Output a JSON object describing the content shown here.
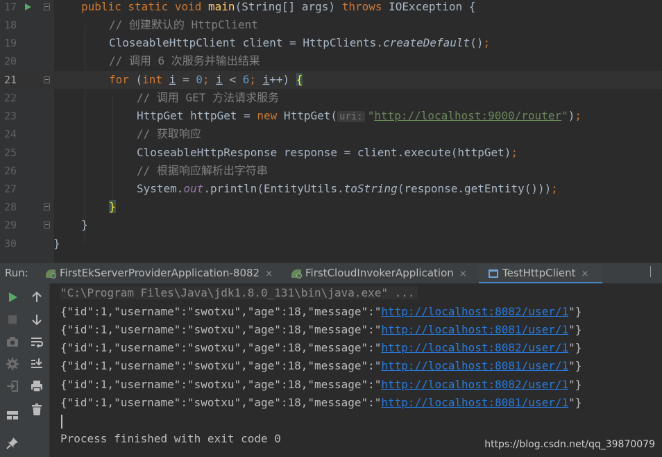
{
  "editor": {
    "line_numbers": [
      "17",
      "18",
      "19",
      "20",
      "21",
      "22",
      "23",
      "24",
      "25",
      "26",
      "27",
      "28",
      "29",
      "30"
    ],
    "line17": {
      "kw1": "public static void ",
      "fn": "main",
      "p1": "(String[] args) ",
      "kw2": "throws",
      "p2": " IOException {"
    },
    "line18": {
      "comment": "// 创建默认的 HttpClient"
    },
    "line19": {
      "p1": "CloseableHttpClient client = HttpClients.",
      "it": "createDefault",
      "p2": "()",
      "semi": ";"
    },
    "line20": {
      "comment": "// 调用 6 次服务并输出结果"
    },
    "line21": {
      "kw1": "for",
      "p1": " (",
      "kw2": "int",
      "sp": " ",
      "v1": "i",
      "p2": " = ",
      "n1": "0",
      "s1": "; ",
      "v2": "i",
      "p3": " < ",
      "n2": "6",
      "s2": "; ",
      "v3": "i",
      "p4": "++) ",
      "brace": "{"
    },
    "line22": {
      "comment": "// 调用 GET 方法请求服务"
    },
    "line23": {
      "p1": "HttpGet httpGet = ",
      "kw": "new",
      "p2": " HttpGet(",
      "hint": "uri:",
      "q1": "\"",
      "url": "http://localhost:9000/router",
      "q2": "\"",
      "p3": ")",
      "semi": ";"
    },
    "line24": {
      "comment": "// 获取响应"
    },
    "line25": {
      "p1": "CloseableHttpResponse response = client.execute(httpGet)",
      "semi": ";"
    },
    "line26": {
      "comment": "// 根据响应解析出字符串"
    },
    "line27": {
      "p1": "System.",
      "fld": "out",
      "p2": ".println(EntityUtils.",
      "it": "toString",
      "p3": "(response.getEntity()))",
      "semi": ";"
    },
    "line28": {
      "brace": "}"
    },
    "line29": {
      "brace": "}"
    },
    "line30": {
      "brace": "}"
    }
  },
  "run_panel": {
    "label": "Run:",
    "tabs": [
      {
        "label": "FirstEkServerProviderApplication-8082",
        "close": "×"
      },
      {
        "label": "FirstCloudInvokerApplication",
        "close": "×"
      },
      {
        "label": "TestHttpClient",
        "close": "×"
      }
    ]
  },
  "console": {
    "command": "\"C:\\Program Files\\Java\\jdk1.8.0_131\\bin\\java.exe\" ...",
    "rows": [
      {
        "prefix": "{\"id\":1,\"username\":\"swotxu\",\"age\":18,\"message\":\"",
        "link": "http://localhost:8082/user/1",
        "suffix": "\"}"
      },
      {
        "prefix": "{\"id\":1,\"username\":\"swotxu\",\"age\":18,\"message\":\"",
        "link": "http://localhost:8081/user/1",
        "suffix": "\"}"
      },
      {
        "prefix": "{\"id\":1,\"username\":\"swotxu\",\"age\":18,\"message\":\"",
        "link": "http://localhost:8082/user/1",
        "suffix": "\"}"
      },
      {
        "prefix": "{\"id\":1,\"username\":\"swotxu\",\"age\":18,\"message\":\"",
        "link": "http://localhost:8081/user/1",
        "suffix": "\"}"
      },
      {
        "prefix": "{\"id\":1,\"username\":\"swotxu\",\"age\":18,\"message\":\"",
        "link": "http://localhost:8082/user/1",
        "suffix": "\"}"
      },
      {
        "prefix": "{\"id\":1,\"username\":\"swotxu\",\"age\":18,\"message\":\"",
        "link": "http://localhost:8081/user/1",
        "suffix": "\"}"
      }
    ],
    "exit_message": "Process finished with exit code 0"
  },
  "watermark": "https://blog.csdn.net/qq_39870079",
  "icons": [
    "run-icon",
    "up-arrow-icon",
    "stop-icon",
    "down-arrow-icon",
    "camera-icon",
    "soft-wrap-icon",
    "settings-icon",
    "scroll-to-end-icon",
    "login-icon",
    "print-icon",
    "layout-icon",
    "trash-icon",
    "pin-icon",
    "spring-leaf-icon",
    "console-window-icon"
  ],
  "colors": {
    "editor_bg": "#2b2b2b",
    "keyword": "#cc7832",
    "method": "#ffc66d",
    "comment": "#808080",
    "number": "#6897bb",
    "string": "#6a8759",
    "link": "#287bde",
    "run_green": "#59a869",
    "tab_accent": "#4a88c7"
  }
}
